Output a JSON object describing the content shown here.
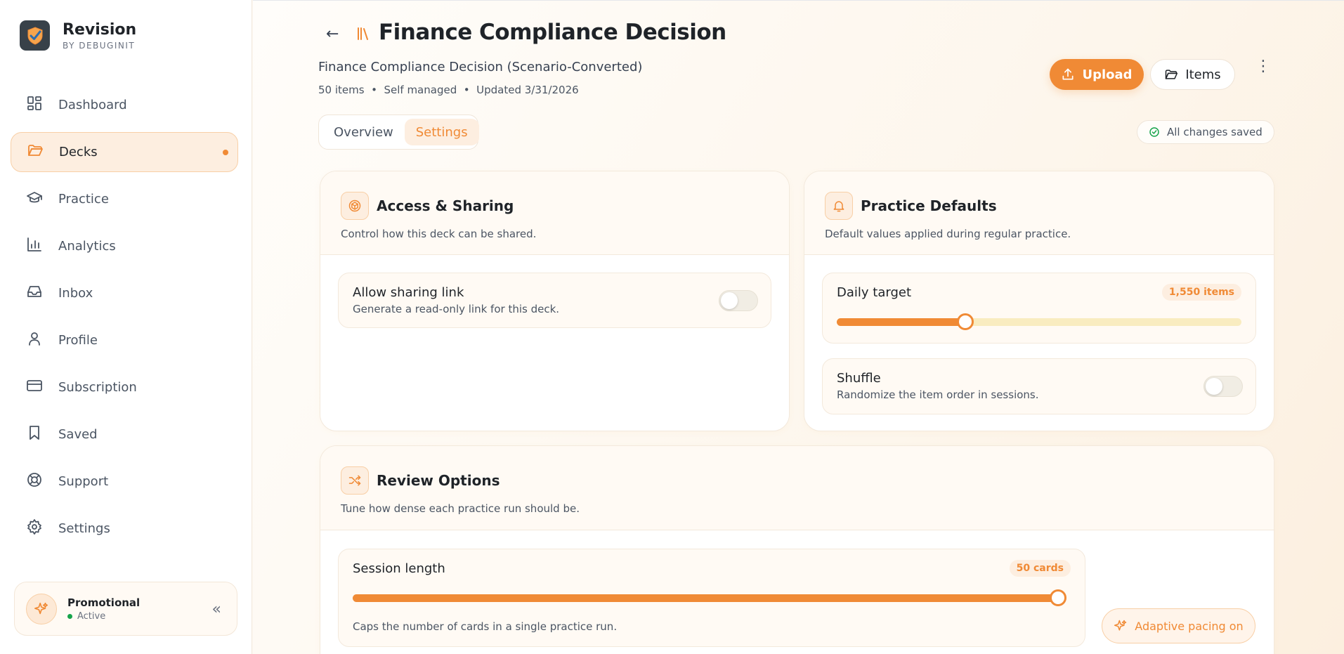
{
  "brand": {
    "name": "Revision",
    "sub": "BY DEBUGINIT"
  },
  "sidebar": {
    "items": [
      {
        "label": "Dashboard",
        "icon": "grid-icon"
      },
      {
        "label": "Decks",
        "icon": "folder-icon",
        "active": true
      },
      {
        "label": "Practice",
        "icon": "graduation-cap-icon"
      },
      {
        "label": "Analytics",
        "icon": "bar-chart-icon"
      },
      {
        "label": "Inbox",
        "icon": "inbox-icon"
      },
      {
        "label": "Profile",
        "icon": "user-icon"
      },
      {
        "label": "Subscription",
        "icon": "credit-card-icon"
      },
      {
        "label": "Saved",
        "icon": "bookmark-icon"
      },
      {
        "label": "Support",
        "icon": "lifebuoy-icon"
      },
      {
        "label": "Settings",
        "icon": "gear-icon"
      }
    ]
  },
  "promo": {
    "title": "Promotional",
    "status": "Active"
  },
  "header": {
    "title": "Finance Compliance Decision",
    "subtitle": "Finance Compliance Decision (Scenario-Converted)",
    "meta": "50 items  •  Self managed  •  Updated 3/31/2026",
    "upload_label": "Upload",
    "items_label": "Items"
  },
  "tabs": [
    {
      "label": "Overview"
    },
    {
      "label": "Settings",
      "active": true
    }
  ],
  "save_status": "All changes saved",
  "access": {
    "title": "Access & Sharing",
    "desc": "Control how this deck can be shared.",
    "sharing": {
      "title": "Allow sharing link",
      "desc": "Generate a read-only link for this deck.",
      "enabled": false
    }
  },
  "practice": {
    "title": "Practice Defaults",
    "desc": "Default values applied during regular practice.",
    "daily_target": {
      "title": "Daily target",
      "badge": "1,550 items",
      "fraction": 0.317
    },
    "shuffle": {
      "title": "Shuffle",
      "desc": "Randomize the item order in sessions.",
      "enabled": false
    }
  },
  "review": {
    "title": "Review Options",
    "desc": "Tune how dense each practice run should be.",
    "session": {
      "title": "Session length",
      "badge": "50 cards",
      "desc": "Caps the number of cards in a single practice run.",
      "fraction": 1.0
    },
    "pacing_label": "Adaptive pacing on"
  },
  "colors": {
    "accent": "#f08a35",
    "success": "#16a34a"
  }
}
